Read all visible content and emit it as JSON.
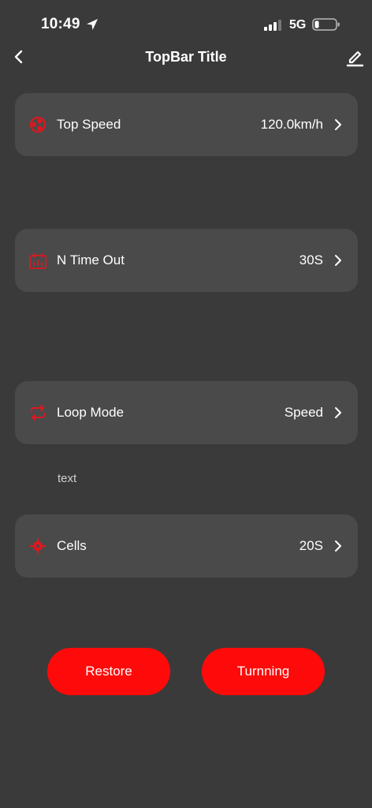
{
  "status_bar": {
    "time": "10:49",
    "network": "5G"
  },
  "top_bar": {
    "title": "TopBar Title"
  },
  "settings": [
    {
      "label": "Top Speed",
      "value": "120.0km/h",
      "icon": "speed-fan-icon"
    },
    {
      "label": "N Time Out",
      "value": "30S",
      "icon": "timer-chart-icon"
    },
    {
      "label": "Loop Mode",
      "value": "Speed",
      "icon": "loop-icon"
    },
    {
      "label": "Cells",
      "value": "20S",
      "icon": "crosshair-icon"
    }
  ],
  "helper_text": "text",
  "buttons": {
    "restore": "Restore",
    "turning": "Turnning"
  },
  "colors": {
    "background": "#3a3a3a",
    "card": "#4a4a4a",
    "accent": "#ff0a0a",
    "icon_red": "#e0161e"
  }
}
